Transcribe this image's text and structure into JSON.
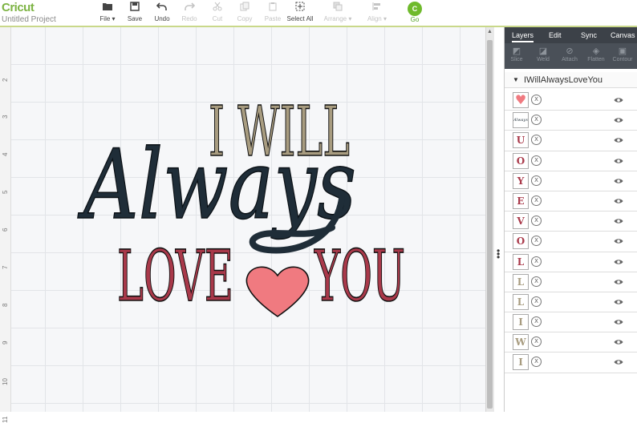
{
  "app": {
    "brand": "Cricut",
    "project_name": "Untitled Project"
  },
  "toolbar": [
    {
      "key": "file",
      "label": "File",
      "icon": "folder-icon",
      "enabled": true,
      "dropdown": true
    },
    {
      "key": "save",
      "label": "Save",
      "icon": "save-icon",
      "enabled": true
    },
    {
      "key": "undo",
      "label": "Undo",
      "icon": "undo-icon",
      "enabled": true
    },
    {
      "key": "redo",
      "label": "Redo",
      "icon": "redo-icon",
      "enabled": false
    },
    {
      "key": "cut",
      "label": "Cut",
      "icon": "cut-icon",
      "enabled": false
    },
    {
      "key": "copy",
      "label": "Copy",
      "icon": "copy-icon",
      "enabled": false
    },
    {
      "key": "paste",
      "label": "Paste",
      "icon": "paste-icon",
      "enabled": false
    },
    {
      "key": "select_all",
      "label": "Select All",
      "icon": "select-all-icon",
      "enabled": true
    },
    {
      "key": "arrange",
      "label": "Arrange",
      "icon": "arrange-icon",
      "enabled": false,
      "dropdown": true
    },
    {
      "key": "align",
      "label": "Align",
      "icon": "align-icon",
      "enabled": false,
      "dropdown": true
    }
  ],
  "go": {
    "label": "Go",
    "badge": "C"
  },
  "ruler": {
    "labels": [
      "2",
      "3",
      "4",
      "5",
      "6",
      "7",
      "8",
      "9",
      "10",
      "11"
    ]
  },
  "design": {
    "line1": "I WILL",
    "line2": "Always",
    "line3a": "LOVE",
    "line3b": "YOU",
    "colors": {
      "tan": "#a89c80",
      "navy": "#1f2d38",
      "red": "#a9394a",
      "heart": "#f07a80"
    }
  },
  "panel": {
    "tabs": [
      "Layers",
      "Edit",
      "Sync",
      "Canvas"
    ],
    "active_tab": "Layers",
    "actions": [
      {
        "label": "Slice",
        "icon": "slice-icon"
      },
      {
        "label": "Weld",
        "icon": "weld-icon"
      },
      {
        "label": "Attach",
        "icon": "attach-icon"
      },
      {
        "label": "Flatten",
        "icon": "flatten-icon"
      },
      {
        "label": "Contour",
        "icon": "contour-icon"
      }
    ],
    "group_name": "IWillAlwaysLoveYou",
    "layers": [
      {
        "thumb": "♥",
        "color": "#f07a80",
        "kind": "heart"
      },
      {
        "thumb": "Always",
        "color": "#1f2d38",
        "kind": "script"
      },
      {
        "thumb": "U",
        "color": "#a9394a"
      },
      {
        "thumb": "O",
        "color": "#a9394a"
      },
      {
        "thumb": "Y",
        "color": "#a9394a"
      },
      {
        "thumb": "E",
        "color": "#a9394a"
      },
      {
        "thumb": "V",
        "color": "#a9394a"
      },
      {
        "thumb": "O",
        "color": "#a9394a"
      },
      {
        "thumb": "L",
        "color": "#a9394a"
      },
      {
        "thumb": "L",
        "color": "#a89c80"
      },
      {
        "thumb": "L",
        "color": "#a89c80"
      },
      {
        "thumb": "I",
        "color": "#a89c80"
      },
      {
        "thumb": "W",
        "color": "#a89c80"
      },
      {
        "thumb": "I",
        "color": "#a89c80"
      }
    ]
  }
}
